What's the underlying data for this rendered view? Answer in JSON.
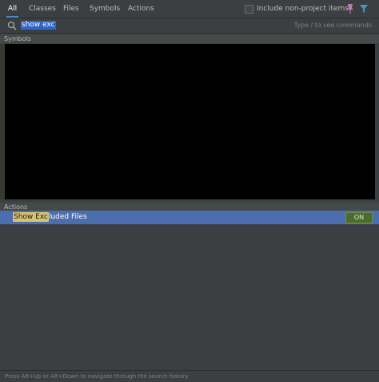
{
  "tabs": [
    {
      "label": "All",
      "active": true
    },
    {
      "label": "Classes",
      "active": false
    },
    {
      "label": "Files",
      "active": false
    },
    {
      "label": "Symbols",
      "active": false
    },
    {
      "label": "Actions",
      "active": false
    }
  ],
  "include_non_project": {
    "label": "Include non-project items",
    "checked": false
  },
  "search": {
    "query": "show exc",
    "hint": "Type / to see commands"
  },
  "sections": {
    "symbols": "Symbols",
    "actions": "Actions"
  },
  "action_item": {
    "match": "Show Exc",
    "rest": "luded Files",
    "toggle": "ON"
  },
  "footer": {
    "text": "Press Alt+Up or Alt+Down to navigate through the search history"
  },
  "icons": {
    "pin": "pin-icon",
    "filter": "filter-icon",
    "search": "search-icon"
  },
  "colors": {
    "accent": "#4a88c7",
    "selection": "#4b6eaf",
    "match_highlight": "#d7c36f",
    "toggle_on": "#4c6b2e"
  }
}
